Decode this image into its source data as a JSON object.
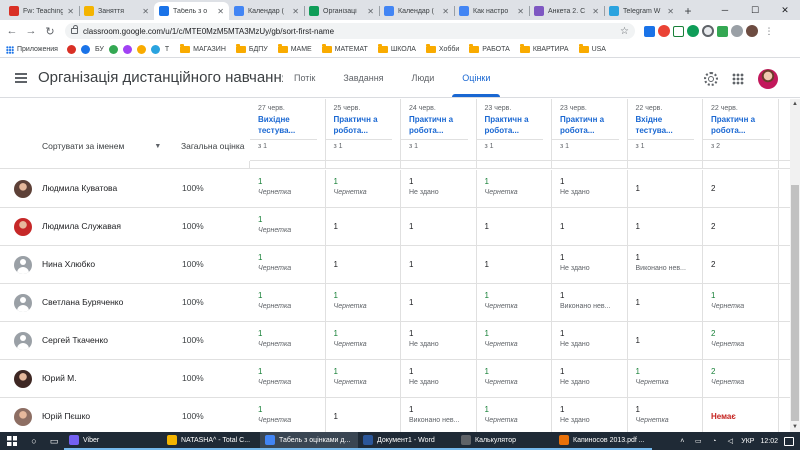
{
  "browser": {
    "tabs": [
      {
        "label": "Fw: Teaching",
        "color": "#d93025",
        "active": false
      },
      {
        "label": "Заняття",
        "color": "#f4b400",
        "active": false
      },
      {
        "label": "Табель з о",
        "color": "#1a73e8",
        "active": true
      },
      {
        "label": "Календар (",
        "color": "#4285f4",
        "active": false
      },
      {
        "label": "Організаці",
        "color": "#0f9d58",
        "active": false
      },
      {
        "label": "Календар (",
        "color": "#4285f4",
        "active": false
      },
      {
        "label": "Как настро",
        "color": "#4285f4",
        "active": false
      },
      {
        "label": "Анкета 2. С",
        "color": "#7e57c2",
        "active": false
      },
      {
        "label": "Telegram W",
        "color": "#2aa3df",
        "active": false
      }
    ],
    "url": "classroom.google.com/u/1/c/MTE0MzM5MTA3MzUy/gb/sort-first-name",
    "bookmarks": {
      "apps_label": "Приложения",
      "icons": [
        {
          "name": "bookmark-red-icon",
          "color": "#d93025"
        },
        {
          "name": "bookmark-eye-icon",
          "color": "#1a73e8"
        },
        {
          "name": "bookmark-green-icon",
          "color": "#34a853"
        },
        {
          "name": "bookmark-purple-icon",
          "color": "#a142f4"
        },
        {
          "name": "bookmark-orange-icon",
          "color": "#f9ab00"
        },
        {
          "name": "bookmark-telegram-icon",
          "color": "#2aa3df"
        }
      ],
      "by": "БУ",
      "t": "T",
      "folders": [
        "МАГАЗИН",
        "БДПУ",
        "МАМЕ",
        "МАТЕМАТ",
        "ШКОЛА",
        "Хобби",
        "РАБОТА",
        "КВАРТИРА",
        "USA"
      ]
    }
  },
  "header": {
    "course_title": "Організація дистанційного навчання з...",
    "tabs": [
      {
        "label": "Потік",
        "active": false
      },
      {
        "label": "Завдання",
        "active": false
      },
      {
        "label": "Люди",
        "active": false
      },
      {
        "label": "Оцінки",
        "active": true
      }
    ]
  },
  "gradebook": {
    "sort_label": "Сортувати за іменем",
    "overall_label": "Загальна оцінка",
    "columns": [
      {
        "date": "27 черв.",
        "title": "Вихідне тестува...",
        "max": "з 1"
      },
      {
        "date": "25 черв.",
        "title": "Практичн а робота...",
        "max": "з 1"
      },
      {
        "date": "24 черв.",
        "title": "Практичн а робота...",
        "max": "з 1"
      },
      {
        "date": "23 черв.",
        "title": "Практичн а робота...",
        "max": "з 1"
      },
      {
        "date": "23 черв.",
        "title": "Практичн а робота...",
        "max": "з 1"
      },
      {
        "date": "22 черв.",
        "title": "Вхідне тестува...",
        "max": "з 1"
      },
      {
        "date": "22 черв.",
        "title": "Практичн а робота...",
        "max": "з 2"
      }
    ],
    "students": [
      {
        "name": "Людмила Куватова",
        "overall": "100%",
        "avatar": "photo",
        "avatar_color": "#5d4037",
        "cells": [
          {
            "grade": "1",
            "status": "Чернетка",
            "style": "green"
          },
          {
            "grade": "1",
            "status": "Чернетка",
            "style": "green"
          },
          {
            "grade": "1",
            "status": "Не здано",
            "style": "plain"
          },
          {
            "grade": "1",
            "status": "Чернетка",
            "style": "green"
          },
          {
            "grade": "1",
            "status": "Не здано",
            "style": "plain"
          },
          {
            "grade": "1",
            "status": "",
            "style": "plain"
          },
          {
            "grade": "2",
            "status": "",
            "style": "plain"
          }
        ]
      },
      {
        "name": "Людмила Служавая",
        "overall": "100%",
        "avatar": "photo",
        "avatar_color": "#c62828",
        "cells": [
          {
            "grade": "1",
            "status": "Чернетка",
            "style": "green"
          },
          {
            "grade": "1",
            "status": "",
            "style": "plain"
          },
          {
            "grade": "1",
            "status": "",
            "style": "plain"
          },
          {
            "grade": "1",
            "status": "",
            "style": "plain"
          },
          {
            "grade": "1",
            "status": "",
            "style": "plain"
          },
          {
            "grade": "1",
            "status": "",
            "style": "plain"
          },
          {
            "grade": "2",
            "status": "",
            "style": "plain"
          }
        ]
      },
      {
        "name": "Нина Хлюбко",
        "overall": "100%",
        "avatar": "default",
        "avatar_color": "#9aa0a6",
        "cells": [
          {
            "grade": "1",
            "status": "Чернетка",
            "style": "green"
          },
          {
            "grade": "1",
            "status": "",
            "style": "plain"
          },
          {
            "grade": "1",
            "status": "",
            "style": "plain"
          },
          {
            "grade": "1",
            "status": "",
            "style": "plain"
          },
          {
            "grade": "1",
            "status": "Не здано",
            "style": "plain"
          },
          {
            "grade": "1",
            "status": "Виконано нев...",
            "style": "plain"
          },
          {
            "grade": "2",
            "status": "",
            "style": "plain"
          }
        ]
      },
      {
        "name": "Светлана Буряченко",
        "overall": "100%",
        "avatar": "default",
        "avatar_color": "#9aa0a6",
        "cells": [
          {
            "grade": "1",
            "status": "Чернетка",
            "style": "green"
          },
          {
            "grade": "1",
            "status": "Чернетка",
            "style": "green"
          },
          {
            "grade": "1",
            "status": "",
            "style": "plain"
          },
          {
            "grade": "1",
            "status": "Чернетка",
            "style": "green"
          },
          {
            "grade": "1",
            "status": "Виконано нев...",
            "style": "plain"
          },
          {
            "grade": "1",
            "status": "",
            "style": "plain"
          },
          {
            "grade": "1",
            "status": "Чернетка",
            "style": "green"
          }
        ]
      },
      {
        "name": "Сергей Ткаченко",
        "overall": "100%",
        "avatar": "default",
        "avatar_color": "#9aa0a6",
        "cells": [
          {
            "grade": "1",
            "status": "Чернетка",
            "style": "green"
          },
          {
            "grade": "1",
            "status": "Чернетка",
            "style": "green"
          },
          {
            "grade": "1",
            "status": "Не здано",
            "style": "plain"
          },
          {
            "grade": "1",
            "status": "Чернетка",
            "style": "green"
          },
          {
            "grade": "1",
            "status": "Не здано",
            "style": "plain"
          },
          {
            "grade": "1",
            "status": "",
            "style": "plain"
          },
          {
            "grade": "2",
            "status": "Чернетка",
            "style": "green"
          }
        ]
      },
      {
        "name": "Юрий М.",
        "overall": "100%",
        "avatar": "photo",
        "avatar_color": "#3e2723",
        "cells": [
          {
            "grade": "1",
            "status": "Чернетка",
            "style": "green"
          },
          {
            "grade": "1",
            "status": "Чернетка",
            "style": "green"
          },
          {
            "grade": "1",
            "status": "Не здано",
            "style": "plain"
          },
          {
            "grade": "1",
            "status": "Чернетка",
            "style": "green"
          },
          {
            "grade": "1",
            "status": "Не здано",
            "style": "plain"
          },
          {
            "grade": "1",
            "status": "Чернетка",
            "style": "green"
          },
          {
            "grade": "2",
            "status": "Чернетка",
            "style": "green"
          }
        ]
      },
      {
        "name": "Юрій Пєшко",
        "overall": "100%",
        "avatar": "photo",
        "avatar_color": "#8d6e63",
        "cells": [
          {
            "grade": "1",
            "status": "Чернетка",
            "style": "green"
          },
          {
            "grade": "1",
            "status": "",
            "style": "plain"
          },
          {
            "grade": "1",
            "status": "Виконано нев...",
            "style": "plain"
          },
          {
            "grade": "1",
            "status": "Чернетка",
            "style": "green"
          },
          {
            "grade": "1",
            "status": "Не здано",
            "style": "plain"
          },
          {
            "grade": "1",
            "status": "Чернетка",
            "style": "plain"
          },
          {
            "grade": "Немає",
            "status": "",
            "style": "red"
          }
        ]
      }
    ]
  },
  "taskbar": {
    "apps": [
      {
        "label": "Viber",
        "color": "#7360f2",
        "active": false
      },
      {
        "label": "NATASHA^ - Total C...",
        "color": "#f4b400",
        "active": false
      },
      {
        "label": "Табель з оцінками д...",
        "color": "#4285f4",
        "active": true
      },
      {
        "label": "Документ1 - Word",
        "color": "#2b579a",
        "active": false
      },
      {
        "label": "Калькулятор",
        "color": "#5f6368",
        "active": false
      },
      {
        "label": "Капиносов 2013.pdf ...",
        "color": "#e8710a",
        "active": false
      }
    ],
    "lang": "УКР",
    "time": "12:02"
  },
  "colors": {
    "accent": "#1967d2",
    "draft_green": "#188038",
    "missing_red": "#c5221f"
  }
}
